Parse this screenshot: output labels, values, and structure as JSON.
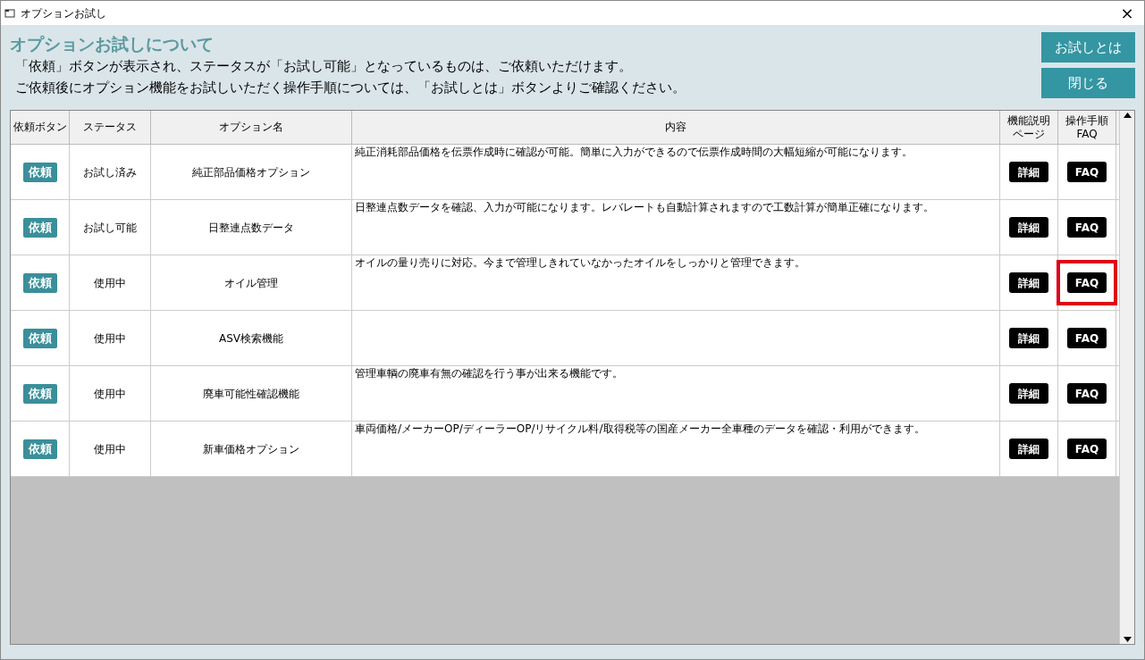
{
  "window": {
    "title": "オプションお試し",
    "close": "×"
  },
  "header": {
    "title": "オプションお試しについて",
    "lines": [
      "「依頼」ボタンが表示され、ステータスが「お試し可能」となっているものは、ご依頼いただけます。",
      "ご依頼後にオプション機能をお試しいただく操作手順については、「お試しとは」ボタンよりご確認ください。"
    ],
    "buttons": [
      "お試しとは",
      "閉じる"
    ]
  },
  "table": {
    "columns": [
      "依頼ボタン",
      "ステータス",
      "オプション名",
      "内容",
      "機能説明ページ",
      "操作手順\nFAQ"
    ],
    "rows": [
      {
        "request": "依頼",
        "status": "お試し済み",
        "name": "純正部品価格オプション",
        "description": "純正消耗部品価格を伝票作成時に確認が可能。簡単に入力ができるので伝票作成時間の大幅短縮が可能になります。",
        "detail": "詳細",
        "faq": "FAQ",
        "highlighted": false
      },
      {
        "request": "依頼",
        "status": "お試し可能",
        "name": "日整連点数データ",
        "description": "日整連点数データを確認、入力が可能になります。レバレートも自動計算されますので工数計算が簡単正確になります。",
        "detail": "詳細",
        "faq": "FAQ",
        "highlighted": false
      },
      {
        "request": "依頼",
        "status": "使用中",
        "name": "オイル管理",
        "description": "オイルの量り売りに対応。今まで管理しきれていなかったオイルをしっかりと管理できます。",
        "detail": "詳細",
        "faq": "FAQ",
        "highlighted": true
      },
      {
        "request": "依頼",
        "status": "使用中",
        "name": "ASV検索機能",
        "detail": "詳細",
        "faq": "FAQ",
        "highlighted": false
      },
      {
        "request": "依頼",
        "status": "使用中",
        "name": "廃車可能性確認機能",
        "description": "管理車輌の廃車有無の確認を行う事が出来る機能です。",
        "detail": "詳細",
        "faq": "FAQ",
        "highlighted": false
      },
      {
        "request": "依頼",
        "status": "使用中",
        "name": "新車価格オプション",
        "description": "車両価格/メーカーOP/ディーラーOP/リサイクル料/取得税等の国産メーカー全車種のデータを確認・利用ができます。",
        "detail": "詳細",
        "faq": "FAQ",
        "highlighted": false
      }
    ]
  }
}
